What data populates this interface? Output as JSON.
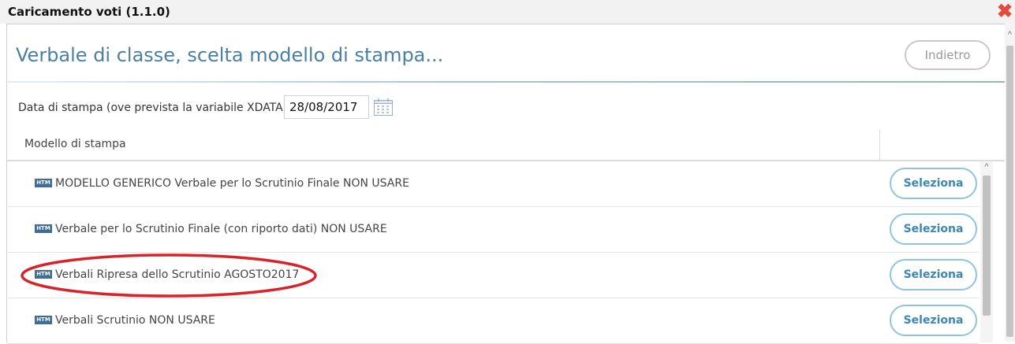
{
  "window": {
    "title": "Caricamento voti (1.1.0)",
    "close_symbol": "✖"
  },
  "header": {
    "heading": "Verbale di classe, scelta modello di stampa...",
    "back_label": "Indietro"
  },
  "date": {
    "label": "Data di stampa (ove prevista la variabile XDATA):",
    "value": "28/08/2017"
  },
  "table": {
    "column_header": "Modello di stampa",
    "rows": [
      {
        "badge": "HTM",
        "name": "MODELLO GENERICO Verbale per lo Scrutinio Finale NON USARE",
        "action": "Seleziona"
      },
      {
        "badge": "HTM",
        "name": "Verbale per lo Scrutinio Finale (con riporto dati) NON USARE",
        "action": "Seleziona"
      },
      {
        "badge": "HTM",
        "name": "Verbali Ripresa dello Scrutinio AGOSTO2017",
        "action": "Seleziona"
      },
      {
        "badge": "HTM",
        "name": "Verbali Scrutinio NON USARE",
        "action": "Seleziona"
      }
    ]
  },
  "annotation": {
    "highlighted_row": 3,
    "color": "#d9232a"
  },
  "colors": {
    "heading": "#4a7fa5",
    "button_border": "#8cc4e2",
    "button_text": "#3d86b8",
    "badge": "#3f6c98",
    "close": "#e24a3c"
  }
}
